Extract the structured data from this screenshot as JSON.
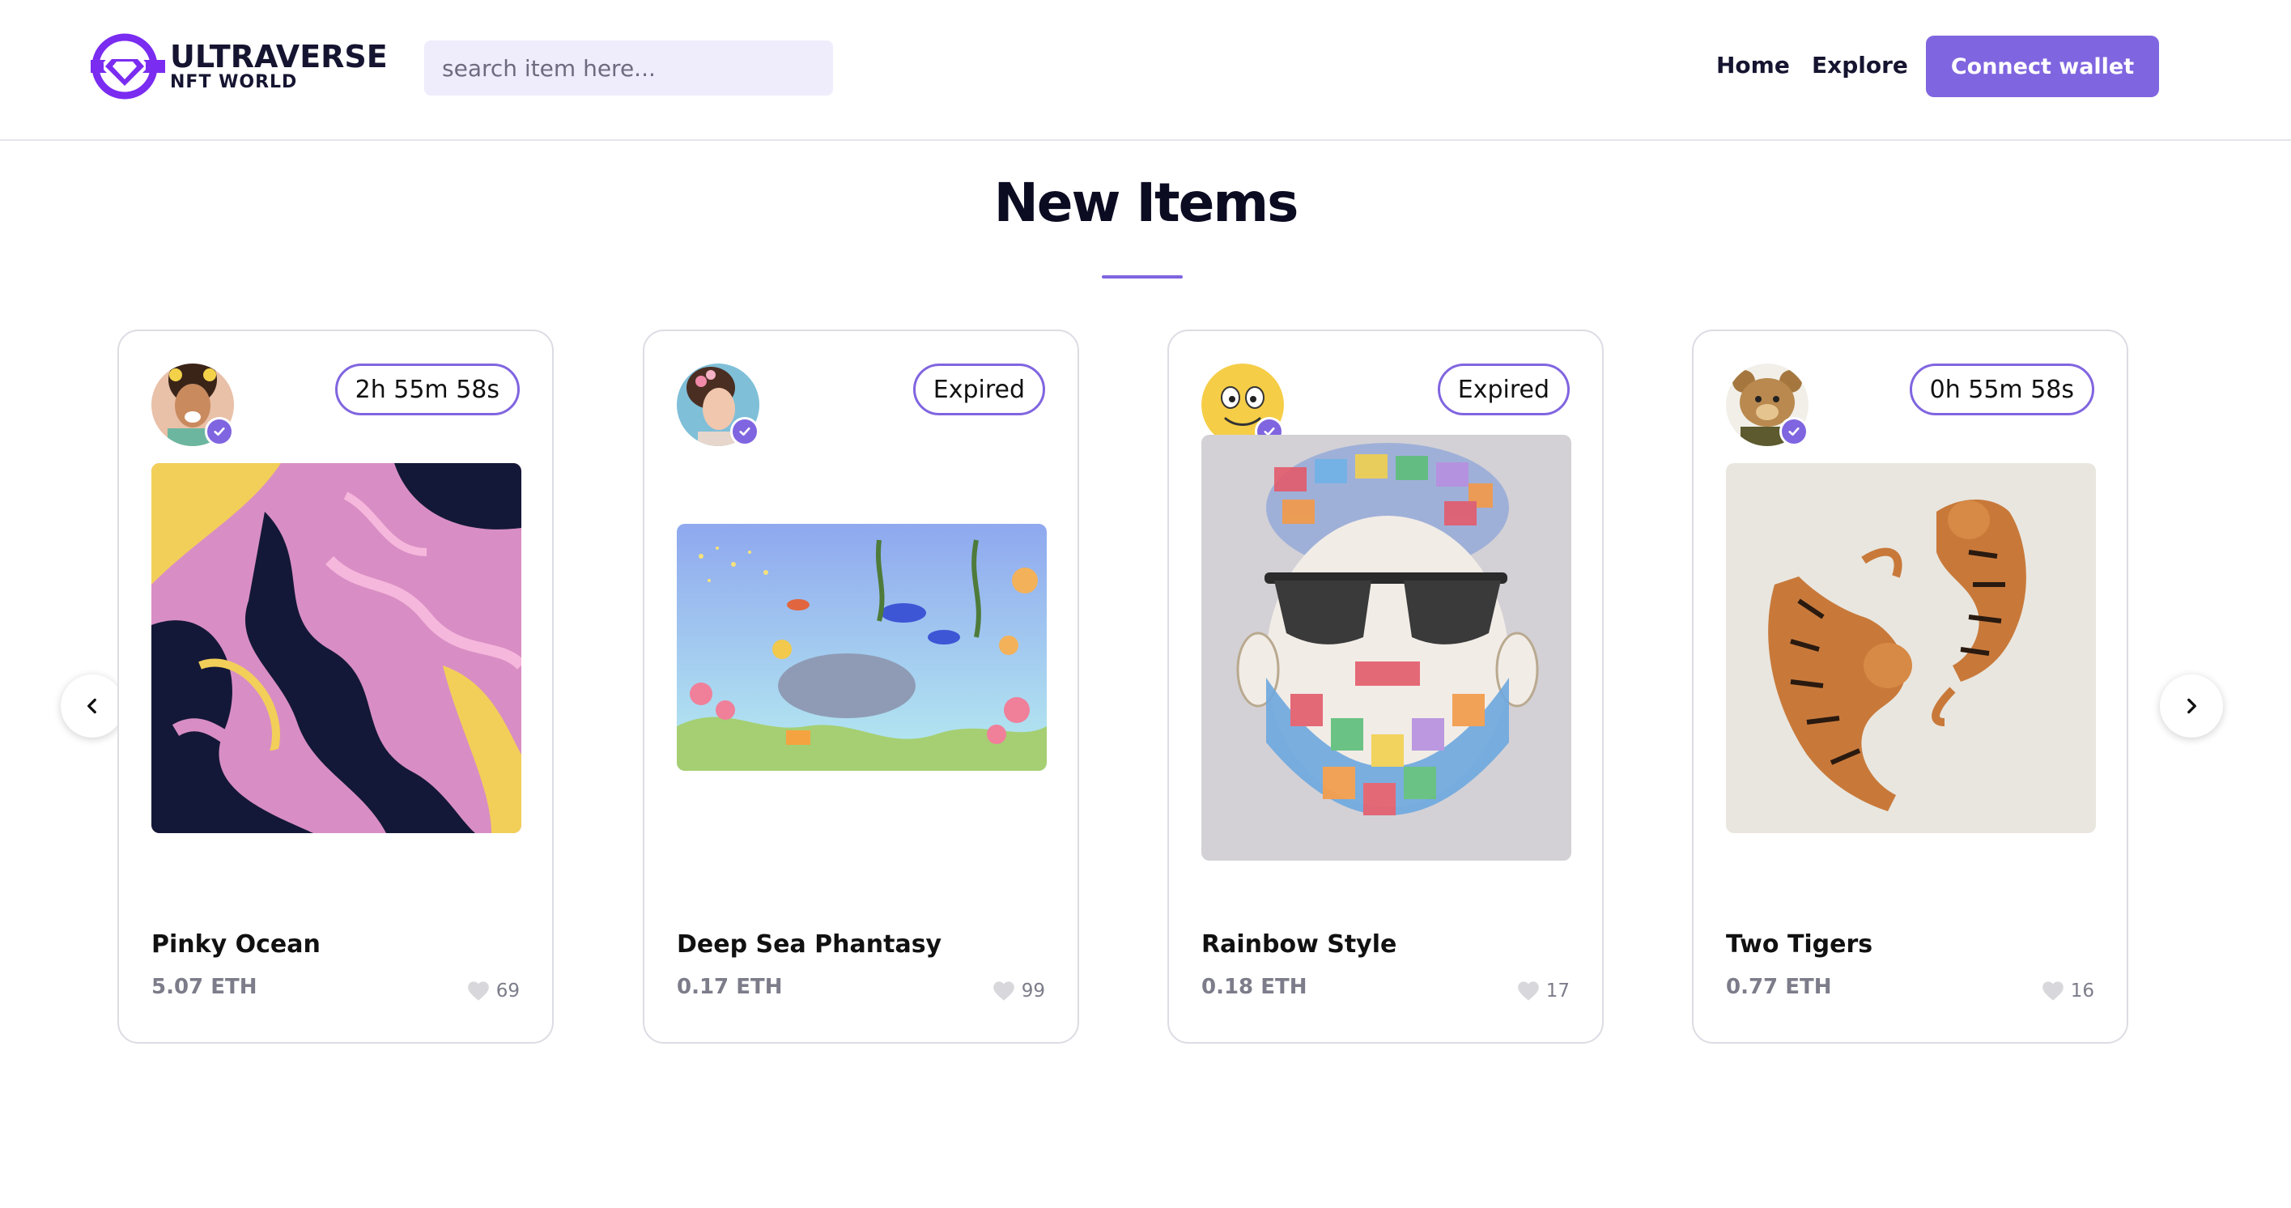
{
  "brand": {
    "title": "ULTRAVERSE",
    "subtitle": "NFT WORLD",
    "accent_color": "#8065e0",
    "logo_icon": "diamond-logo-icon"
  },
  "search": {
    "placeholder": "search item here..."
  },
  "nav": {
    "home": "Home",
    "explore": "Explore",
    "connect_wallet": "Connect wallet"
  },
  "section": {
    "title": "New Items"
  },
  "carousel": {
    "prev_icon": "chevron-left-icon",
    "next_icon": "chevron-right-icon"
  },
  "items": [
    {
      "name": "Pinky Ocean",
      "price": "5.07 ETH",
      "likes": "69",
      "timer": "2h 55m 58s",
      "verified": true
    },
    {
      "name": "Deep Sea Phantasy",
      "price": "0.17 ETH",
      "likes": "99",
      "timer": "Expired",
      "verified": true
    },
    {
      "name": "Rainbow Style",
      "price": "0.18 ETH",
      "likes": "17",
      "timer": "Expired",
      "verified": true
    },
    {
      "name": "Two Tigers",
      "price": "0.77 ETH",
      "likes": "16",
      "timer": "0h 55m 58s",
      "verified": true
    }
  ]
}
